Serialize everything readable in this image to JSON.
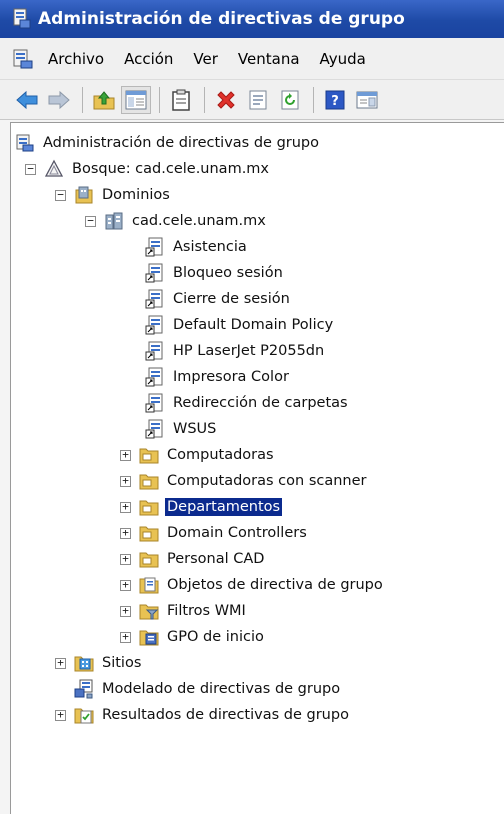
{
  "window": {
    "title": "Administración de directivas de grupo"
  },
  "menu": {
    "items": [
      "Archivo",
      "Acción",
      "Ver",
      "Ventana",
      "Ayuda"
    ]
  },
  "toolbar": {
    "buttons": [
      "back-arrow-icon",
      "forward-arrow-icon",
      "up-folder-icon",
      "show-hide-tree-icon",
      "clipboard-icon",
      "delete-x-icon",
      "properties-icon",
      "refresh-icon",
      "help-icon",
      "console-pane-icon"
    ]
  },
  "tree": {
    "root": "Administración de directivas de grupo",
    "forest": "Bosque: cad.cele.unam.mx",
    "domains": "Dominios",
    "domain": "cad.cele.unam.mx",
    "gpos": [
      "Asistencia",
      "Bloqueo sesión",
      "Cierre de sesión",
      "Default Domain Policy",
      "HP LaserJet P2055dn",
      "Impresora Color",
      "Redirección de carpetas",
      "WSUS"
    ],
    "containers": [
      "Computadoras",
      "Computadoras con scanner",
      "Departamentos",
      "Domain Controllers",
      "Personal CAD",
      "Objetos de directiva de grupo",
      "Filtros WMI",
      "GPO de inicio"
    ],
    "selected": "Departamentos",
    "sites": "Sitios",
    "modeling": "Modelado de directivas de grupo",
    "results": "Resultados de directivas de grupo"
  },
  "colors": {
    "titlebar": "#1e4aa6",
    "selection": "#0b2a8e",
    "folder": "#e8c253"
  }
}
